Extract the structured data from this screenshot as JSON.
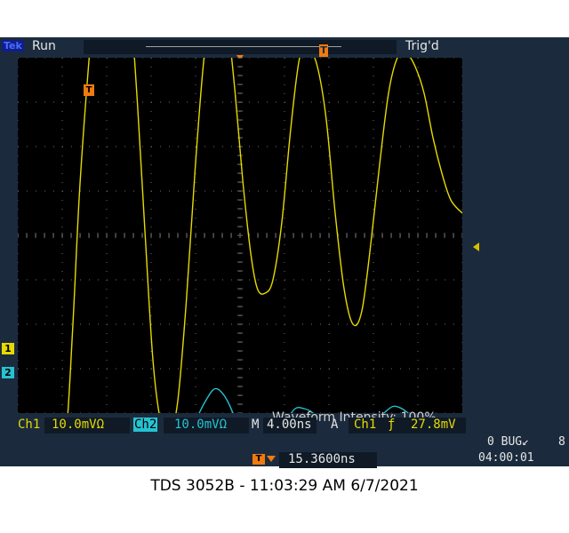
{
  "status": {
    "brand": "Tek",
    "run": "Run",
    "trigger": "Trig'd",
    "trigger_pos_glyph": "T",
    "trigger_marker_glyph": "T"
  },
  "channel_markers": {
    "ch1": "1",
    "ch2": "2"
  },
  "display": {
    "intensity": "Waveform Intensity: 100%"
  },
  "readouts": {
    "ch1_label": "Ch1",
    "ch1_scale": "10.0mVΩ",
    "ch2_label": "Ch2",
    "ch2_scale": "10.0mVΩ",
    "time_label": "M",
    "time_scale": "4.00ns",
    "acq_label": "A",
    "trig_source": "Ch1",
    "trig_slope": "ƒ",
    "trig_level": "27.8mV",
    "bug_label": "0 BUG↙",
    "bug_count": "8",
    "clock": "04:00:01",
    "hpos_icon": "T",
    "hpos_value": "15.3600ns"
  },
  "caption": "TDS 3052B - 11:03:29 AM   6/7/2021",
  "colors": {
    "ch1": "#e6da00",
    "ch2": "#25c2d2",
    "grid": "#6e6e6e",
    "accent": "#f07a10"
  },
  "chart_data": {
    "type": "line",
    "title": "",
    "xlabel": "",
    "ylabel": "",
    "x_unit": "ns",
    "x_range": [
      -15.36,
      24.64
    ],
    "y_unit": "mV",
    "grid": "10 x 8 divisions, dotted",
    "series": [
      {
        "name": "Ch1",
        "color": "#e6da00",
        "points": [
          [
            -15.36,
            -46.0
          ],
          [
            -11.6,
            -46.0
          ],
          [
            -11.0,
            -44.5
          ],
          [
            -10.4,
            -20.0
          ],
          [
            -9.8,
            10.0
          ],
          [
            -9.0,
            38.0
          ],
          [
            -8.2,
            60.0
          ],
          [
            -7.5,
            72.0
          ],
          [
            -6.9,
            75.0
          ],
          [
            -6.2,
            72.0
          ],
          [
            -5.4,
            58.0
          ],
          [
            -4.6,
            30.0
          ],
          [
            -3.9,
            0.0
          ],
          [
            -3.2,
            -28.0
          ],
          [
            -2.5,
            -42.0
          ],
          [
            -1.8,
            -45.0
          ],
          [
            -1.0,
            -38.0
          ],
          [
            -0.2,
            -15.0
          ],
          [
            0.6,
            15.0
          ],
          [
            1.4,
            40.0
          ],
          [
            2.2,
            52.0
          ],
          [
            2.8,
            54.0
          ],
          [
            3.5,
            48.0
          ],
          [
            4.2,
            32.0
          ],
          [
            4.9,
            12.0
          ],
          [
            5.6,
            -4.0
          ],
          [
            6.2,
            -12.0
          ],
          [
            6.9,
            -13.0
          ],
          [
            7.6,
            -10.0
          ],
          [
            8.4,
            3.0
          ],
          [
            9.2,
            24.0
          ],
          [
            10.0,
            40.0
          ],
          [
            10.8,
            42.0
          ],
          [
            11.6,
            38.0
          ],
          [
            12.4,
            26.0
          ],
          [
            13.2,
            5.0
          ],
          [
            14.0,
            -12.0
          ],
          [
            14.8,
            -20.0
          ],
          [
            15.6,
            -17.0
          ],
          [
            16.4,
            -2.0
          ],
          [
            17.2,
            16.0
          ],
          [
            18.0,
            32.0
          ],
          [
            18.8,
            40.0
          ],
          [
            19.6,
            41.0
          ],
          [
            20.4,
            38.0
          ],
          [
            21.2,
            32.0
          ],
          [
            22.0,
            22.0
          ],
          [
            22.8,
            14.0
          ],
          [
            23.6,
            8.0
          ],
          [
            24.64,
            5.0
          ]
        ]
      },
      {
        "name": "Ch2",
        "color": "#25c2d2",
        "points": [
          [
            -15.36,
            -56.5
          ],
          [
            -9.0,
            -56.5
          ],
          [
            -4.0,
            -56.8
          ],
          [
            -1.6,
            -57.0
          ],
          [
            -0.8,
            -55.0
          ],
          [
            0.0,
            -47.0
          ],
          [
            0.8,
            -41.0
          ],
          [
            1.6,
            -37.0
          ],
          [
            2.4,
            -34.5
          ],
          [
            3.2,
            -36.0
          ],
          [
            4.0,
            -40.0
          ],
          [
            4.8,
            -46.0
          ],
          [
            5.6,
            -51.0
          ],
          [
            6.4,
            -53.5
          ],
          [
            7.2,
            -52.5
          ],
          [
            8.0,
            -47.0
          ],
          [
            8.8,
            -42.0
          ],
          [
            9.6,
            -39.0
          ],
          [
            10.4,
            -39.0
          ],
          [
            11.2,
            -40.0
          ],
          [
            12.0,
            -43.0
          ],
          [
            12.8,
            -46.0
          ],
          [
            13.6,
            -48.5
          ],
          [
            14.4,
            -49.0
          ],
          [
            15.2,
            -47.0
          ],
          [
            16.0,
            -44.0
          ],
          [
            16.8,
            -42.0
          ],
          [
            17.6,
            -40.0
          ],
          [
            18.4,
            -38.5
          ],
          [
            19.2,
            -39.0
          ],
          [
            20.0,
            -40.5
          ],
          [
            20.8,
            -42.5
          ],
          [
            21.6,
            -44.0
          ],
          [
            22.4,
            -45.0
          ],
          [
            23.2,
            -46.0
          ],
          [
            24.64,
            -47.0
          ]
        ]
      }
    ]
  }
}
